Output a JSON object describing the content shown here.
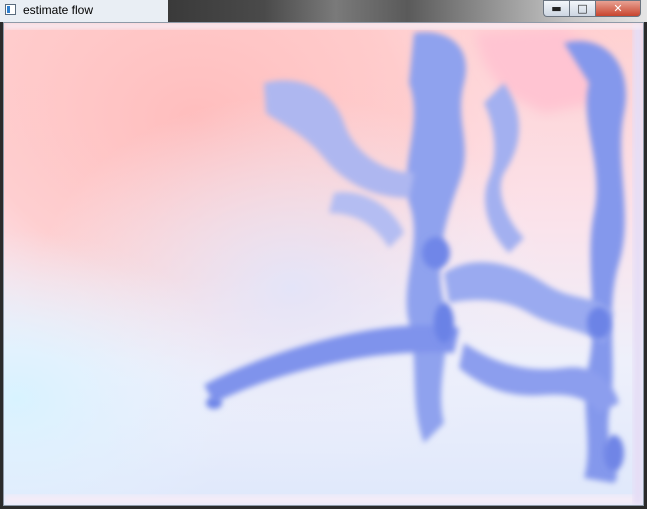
{
  "window": {
    "title": "estimate flow",
    "controls": {
      "minimize_icon": "minimize-icon",
      "maximize_icon": "maximize-icon",
      "close_icon": "close-icon"
    }
  },
  "colors": {
    "pink_region": "#ffc2c2",
    "blue_branch": "#7f93ec",
    "light_background": "#eef0fb"
  }
}
